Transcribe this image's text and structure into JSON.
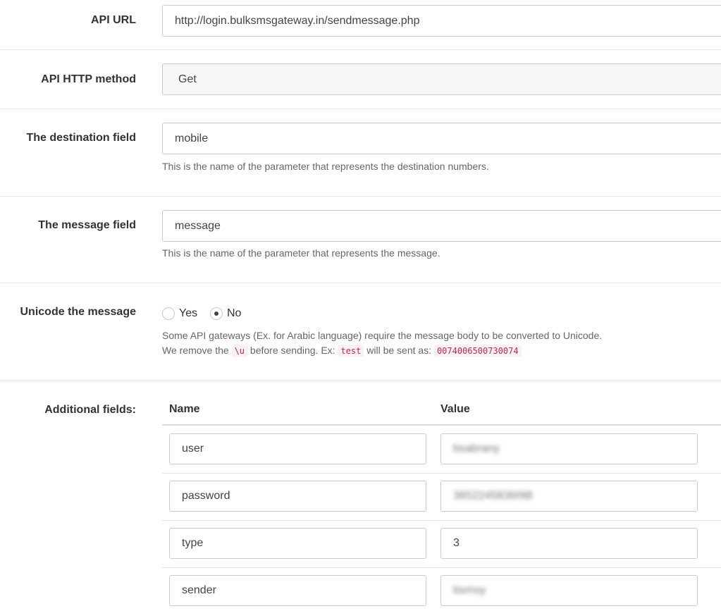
{
  "api_url": {
    "label": "API URL",
    "value": "http://login.bulksmsgateway.in/sendmessage.php"
  },
  "http_method": {
    "label": "API HTTP method",
    "value": "Get"
  },
  "destination": {
    "label": "The destination field",
    "value": "mobile",
    "help": "This is the name of the parameter that represents the destination numbers."
  },
  "message": {
    "label": "The message field",
    "value": "message",
    "help": "This is the name of the parameter that represents the message."
  },
  "unicode": {
    "label": "Unicode the message",
    "options": [
      {
        "label": "Yes",
        "checked": false
      },
      {
        "label": "No",
        "checked": true
      }
    ],
    "help_line1": "Some API gateways (Ex. for Arabic language) require the message body to be converted to Unicode.",
    "help_line2": {
      "part1": "We remove the",
      "code1": "\\u",
      "part2": "before sending. Ex:",
      "code2": "test",
      "part3": "will be sent as:",
      "code3": "0074006500730074"
    }
  },
  "additional": {
    "label": "Additional fields:",
    "col_name": "Name",
    "col_value": "Value",
    "rows": [
      {
        "name": "user",
        "value": "bsabrany"
      },
      {
        "name": "password",
        "value": "3652245836I9B"
      },
      {
        "name": "type",
        "value": "3"
      },
      {
        "name": "sender",
        "value": "bsmsy"
      }
    ]
  }
}
